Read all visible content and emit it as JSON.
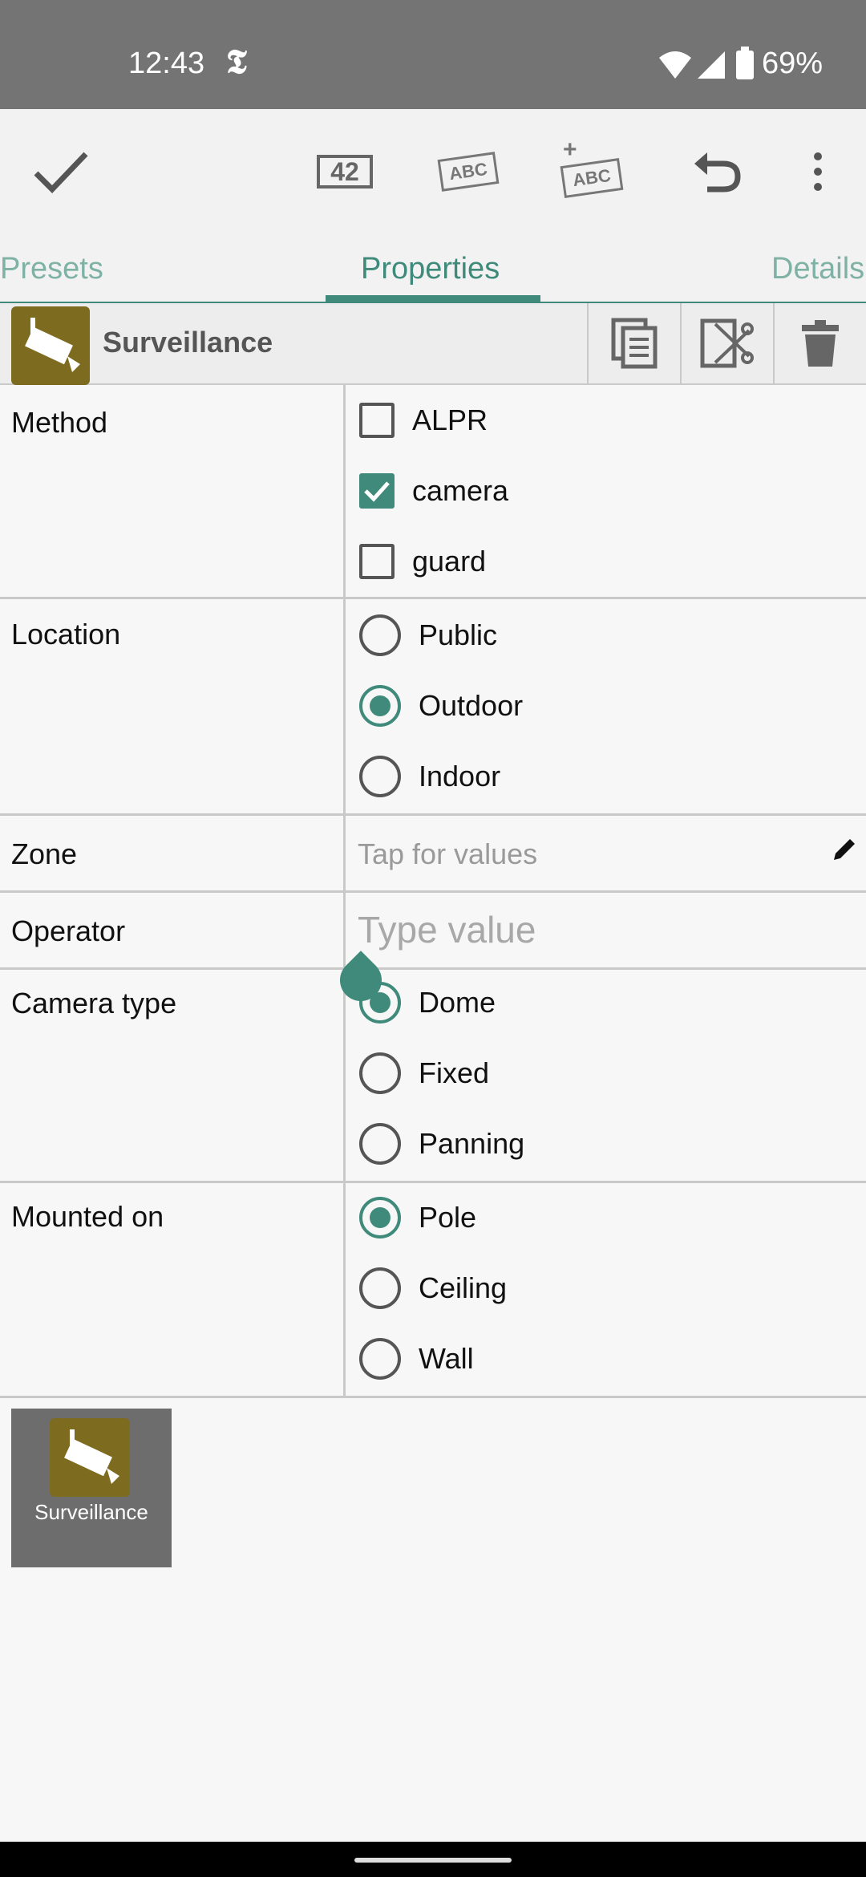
{
  "status": {
    "time": "12:43",
    "nyt": "𝕿",
    "battery": "69%"
  },
  "toolbar": {
    "confirm_icon": "check-icon",
    "number_badge": "42",
    "abc_badge": "ABC",
    "add_abc_badge": "ABC",
    "add_plus": "+",
    "undo_icon": "undo-icon",
    "menu_icon": "more-vert-icon"
  },
  "tabs": [
    {
      "label": "Presets"
    },
    {
      "label": "Properties"
    },
    {
      "label": "Details"
    }
  ],
  "header": {
    "title": "Surveillance"
  },
  "form": {
    "method": {
      "label": "Method",
      "options": [
        {
          "label": "ALPR",
          "checked": false
        },
        {
          "label": "camera",
          "checked": true
        },
        {
          "label": "guard",
          "checked": false
        }
      ]
    },
    "location": {
      "label": "Location",
      "options": [
        {
          "label": "Public",
          "checked": false
        },
        {
          "label": "Outdoor",
          "checked": true
        },
        {
          "label": "Indoor",
          "checked": false
        }
      ]
    },
    "zone": {
      "label": "Zone",
      "hint": "Tap for values"
    },
    "operator": {
      "label": "Operator",
      "placeholder": "Type value"
    },
    "camera_type": {
      "label": "Camera type",
      "options": [
        {
          "label": "Dome",
          "checked": true
        },
        {
          "label": "Fixed",
          "checked": false
        },
        {
          "label": "Panning",
          "checked": false
        }
      ]
    },
    "mounted_on": {
      "label": "Mounted on",
      "options": [
        {
          "label": "Pole",
          "checked": true
        },
        {
          "label": "Ceiling",
          "checked": false
        },
        {
          "label": "Wall",
          "checked": false
        }
      ]
    }
  },
  "preset": {
    "name": "Surveillance"
  },
  "colors": {
    "accent": "#3f8a7a",
    "preset_icon_bg": "#7d6b20"
  }
}
